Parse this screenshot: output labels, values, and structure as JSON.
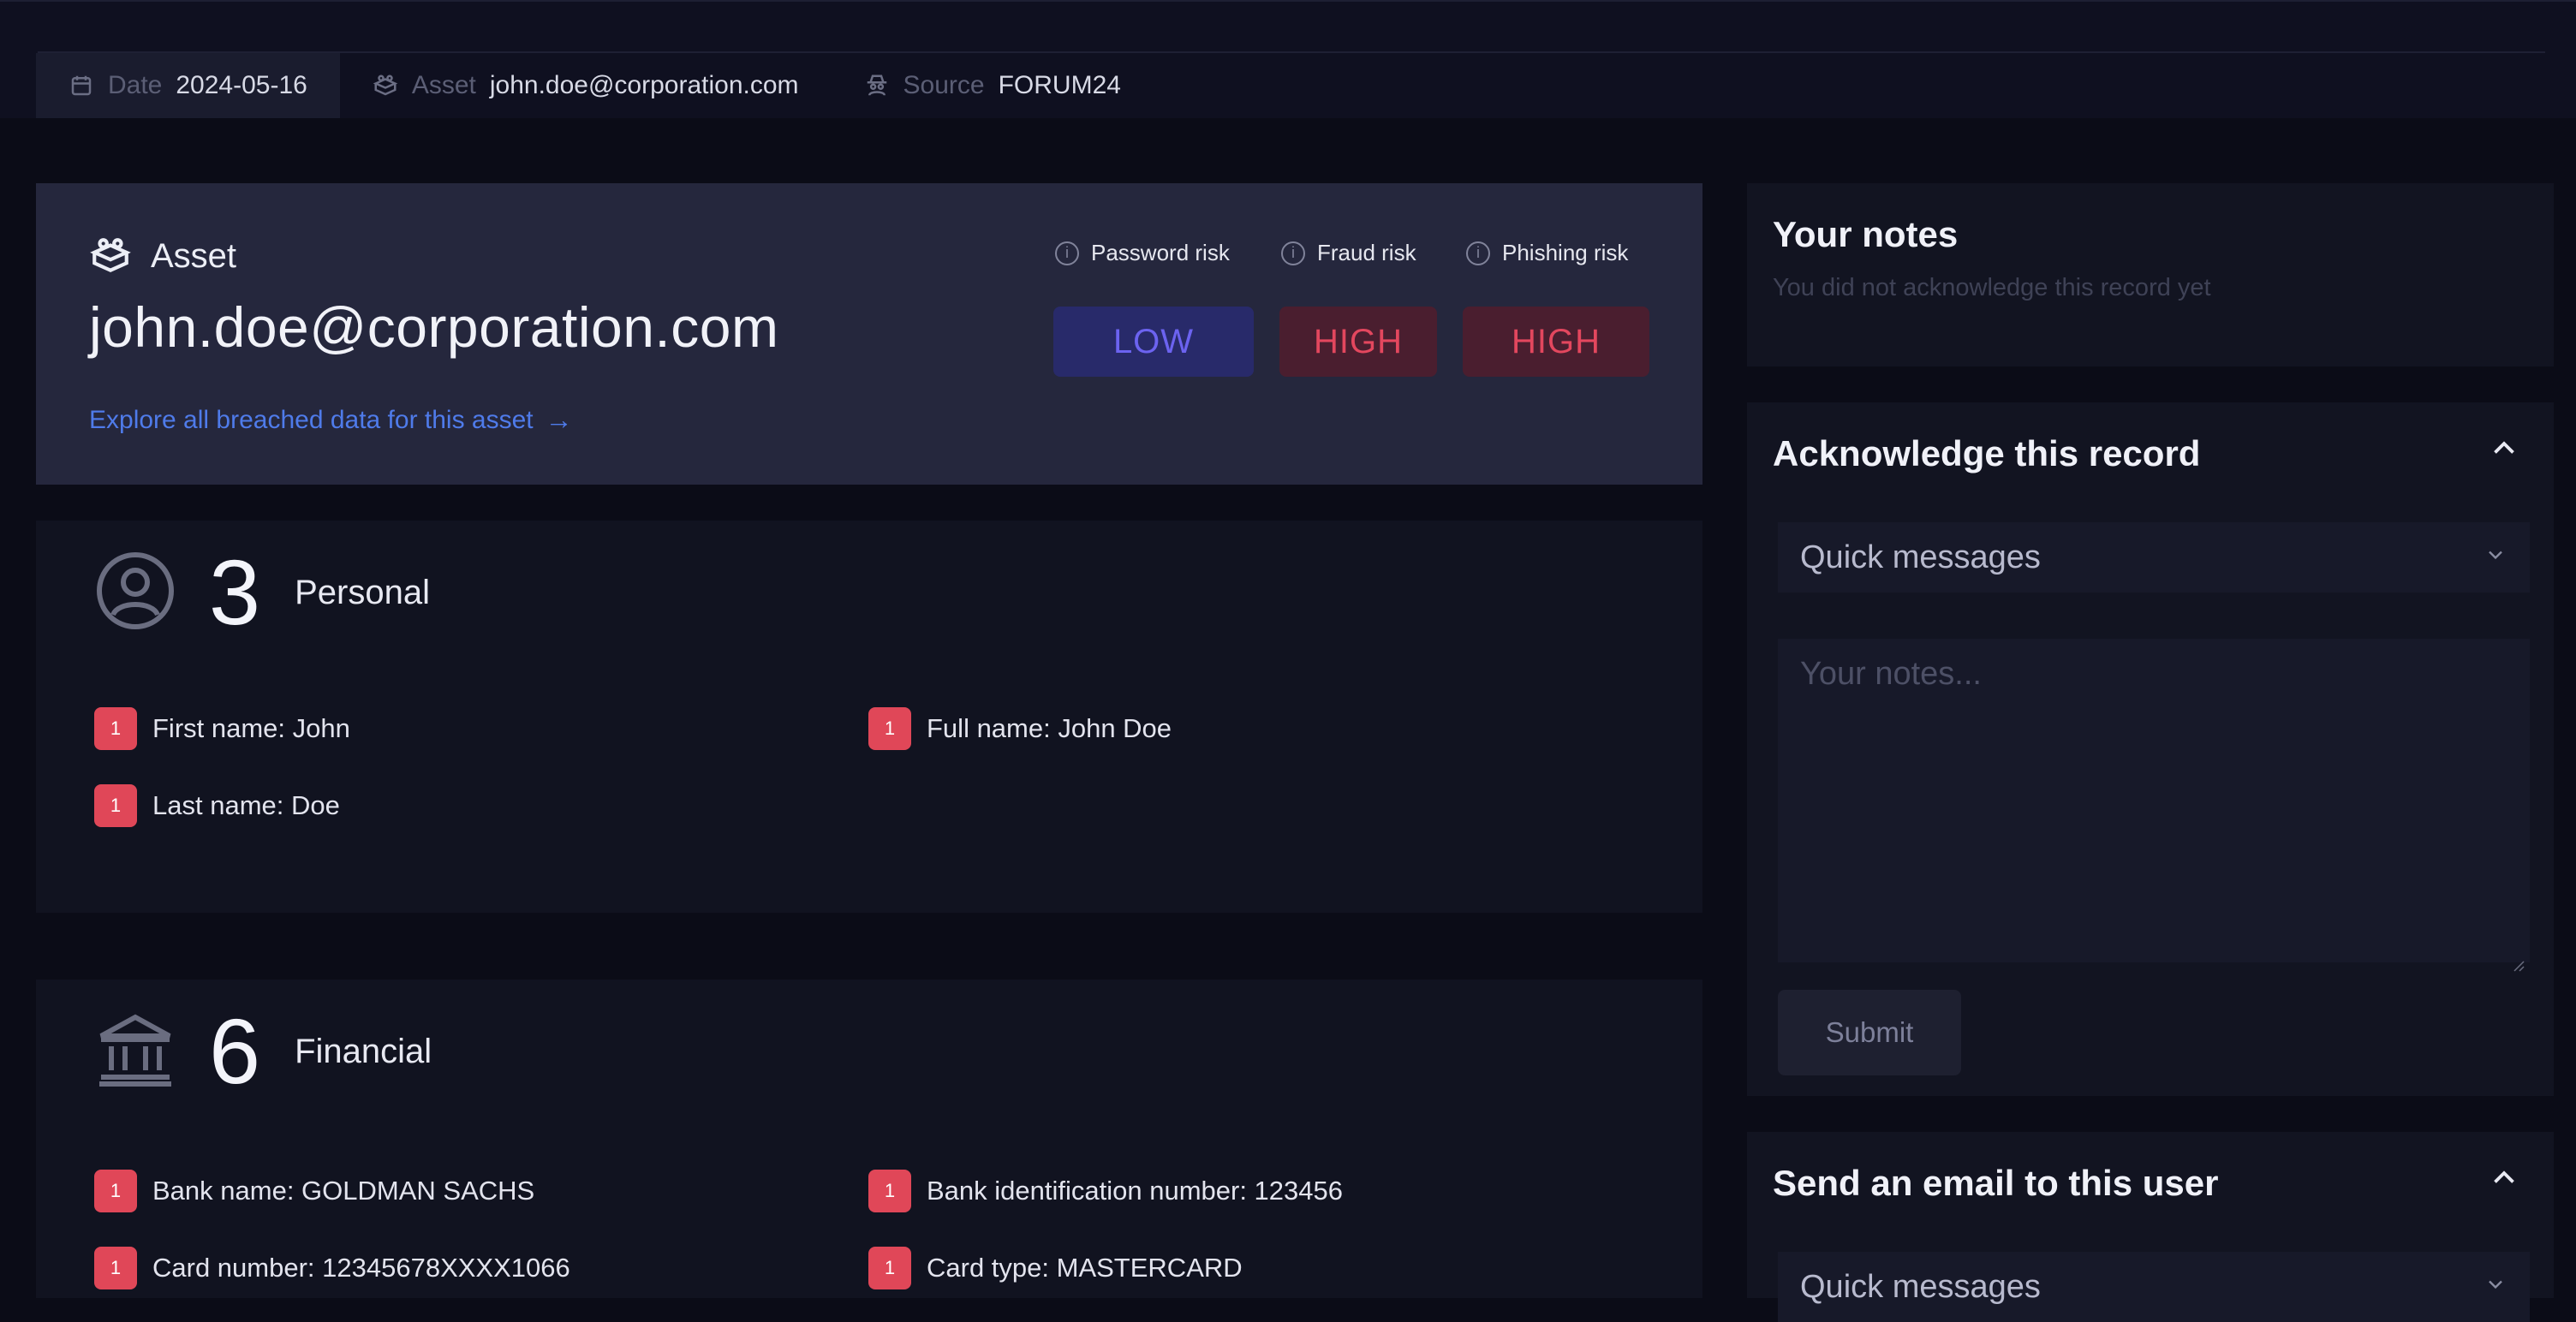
{
  "meta": {
    "date_label": "Date",
    "date_value": "2024-05-16",
    "asset_label": "Asset",
    "asset_value": "john.doe@corporation.com",
    "source_label": "Source",
    "source_value": "FORUM24"
  },
  "asset_card": {
    "heading": "Asset",
    "email": "john.doe@corporation.com",
    "explore_link": "Explore all breached data for this asset",
    "risks": [
      {
        "label": "Password risk",
        "level": "LOW"
      },
      {
        "label": "Fraud risk",
        "level": "HIGH"
      },
      {
        "label": "Phishing risk",
        "level": "HIGH"
      }
    ]
  },
  "personal": {
    "count": "3",
    "title": "Personal",
    "items": [
      {
        "badge": "1",
        "text": "First name: John"
      },
      {
        "badge": "1",
        "text": "Full name: John Doe"
      },
      {
        "badge": "1",
        "text": "Last name: Doe"
      }
    ]
  },
  "financial": {
    "count": "6",
    "title": "Financial",
    "items": [
      {
        "badge": "1",
        "text": "Bank name: GOLDMAN SACHS"
      },
      {
        "badge": "1",
        "text": "Bank identification number: 123456"
      },
      {
        "badge": "1",
        "text": "Card number: 12345678XXXX1066"
      },
      {
        "badge": "1",
        "text": "Card type: MASTERCARD"
      }
    ]
  },
  "notes": {
    "title": "Your notes",
    "subtitle": "You did not acknowledge this record yet"
  },
  "acknowledge": {
    "title": "Acknowledge this record",
    "quick_messages": "Quick messages",
    "notes_placeholder": "Your notes...",
    "submit": "Submit"
  },
  "email_user": {
    "title": "Send an email to this user",
    "quick_messages": "Quick messages"
  },
  "colors": {
    "accent_link": "#4f7bea",
    "risk_low": "#6c63f0",
    "risk_high": "#e3475e",
    "badge": "#e04758"
  }
}
